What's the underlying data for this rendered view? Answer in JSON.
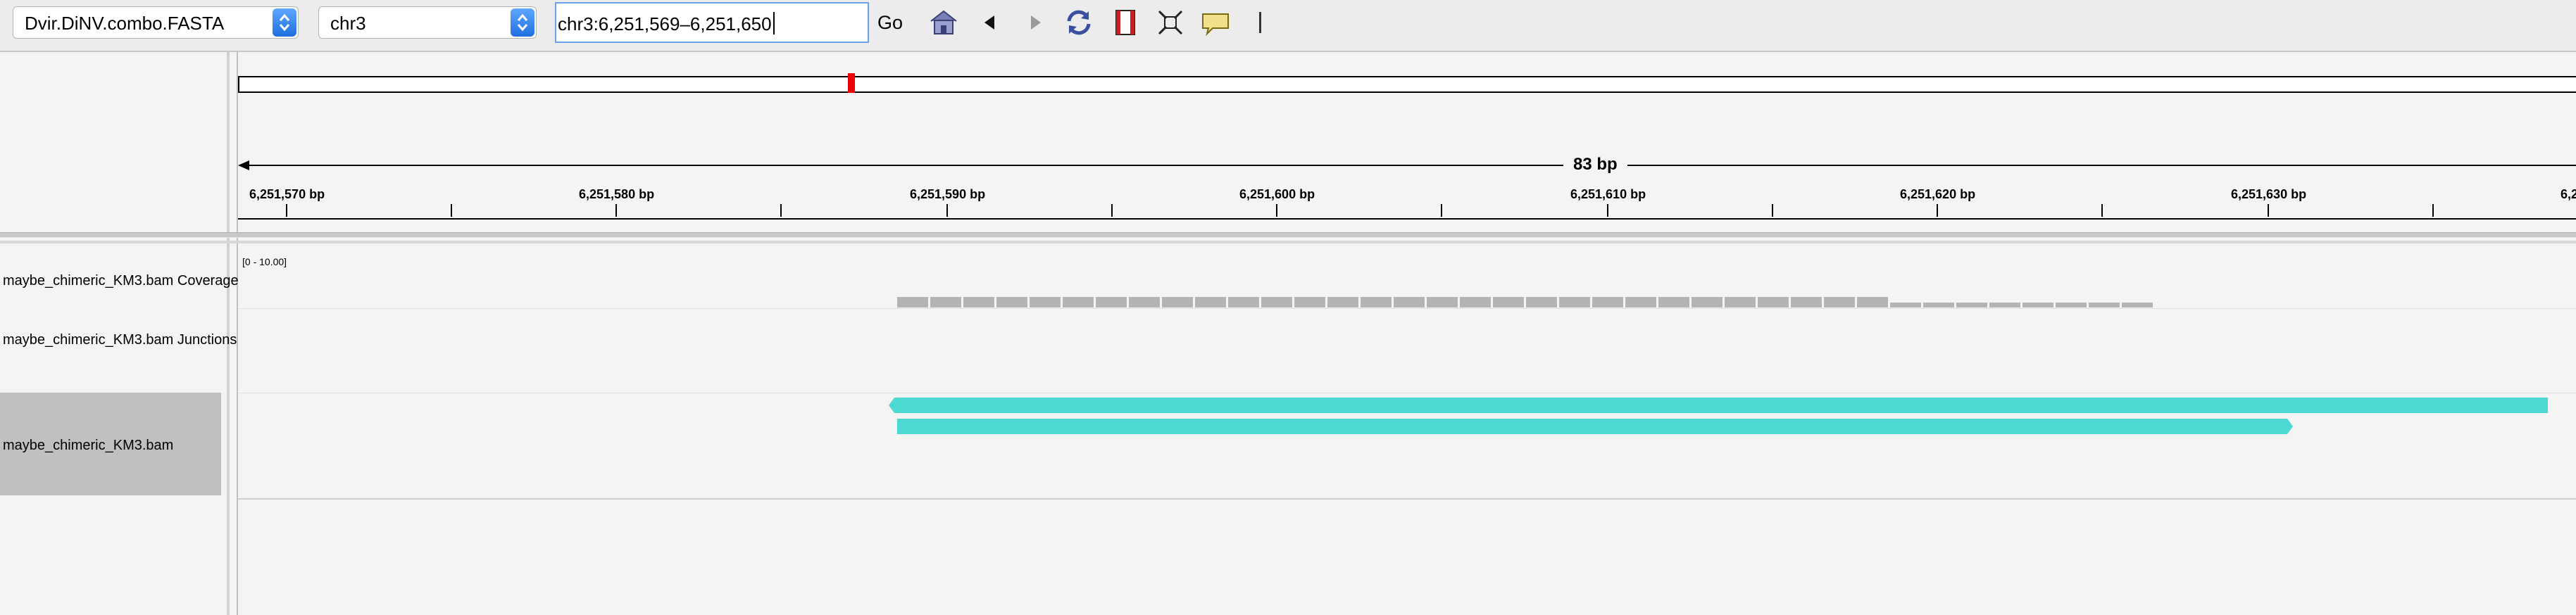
{
  "toolbar": {
    "genome": "Dvir.DiNV.combo.FASTA",
    "chromosome": "chr3",
    "locus": "chr3:6,251,569–6,251,650",
    "go_label": "Go",
    "icons": [
      "home-icon",
      "back-icon",
      "forward-icon",
      "refresh-icon",
      "ruler-icon",
      "fit-window-icon",
      "popup-text-icon"
    ]
  },
  "ruler": {
    "scale": "83 bp",
    "ticks": [
      "6,251,570 bp",
      "6,251,580 bp",
      "6,251,590 bp",
      "6,251,600 bp",
      "6,251,610 bp",
      "6,251,620 bp",
      "6,251,630 bp",
      "6,2"
    ]
  },
  "tracks": {
    "coverage": {
      "name": "maybe_chimeric_KM3.bam Coverage",
      "range": "[0 - 10.00]"
    },
    "junctions": {
      "name": "maybe_chimeric_KM3.bam Junctions"
    },
    "alignments": {
      "name": "maybe_chimeric_KM3.bam"
    }
  },
  "colors": {
    "read": "#4dd8d4",
    "coverage": "#b4b4b4",
    "ideogram_marker": "#e00000",
    "combo_arrow": "#2f7ff0"
  }
}
